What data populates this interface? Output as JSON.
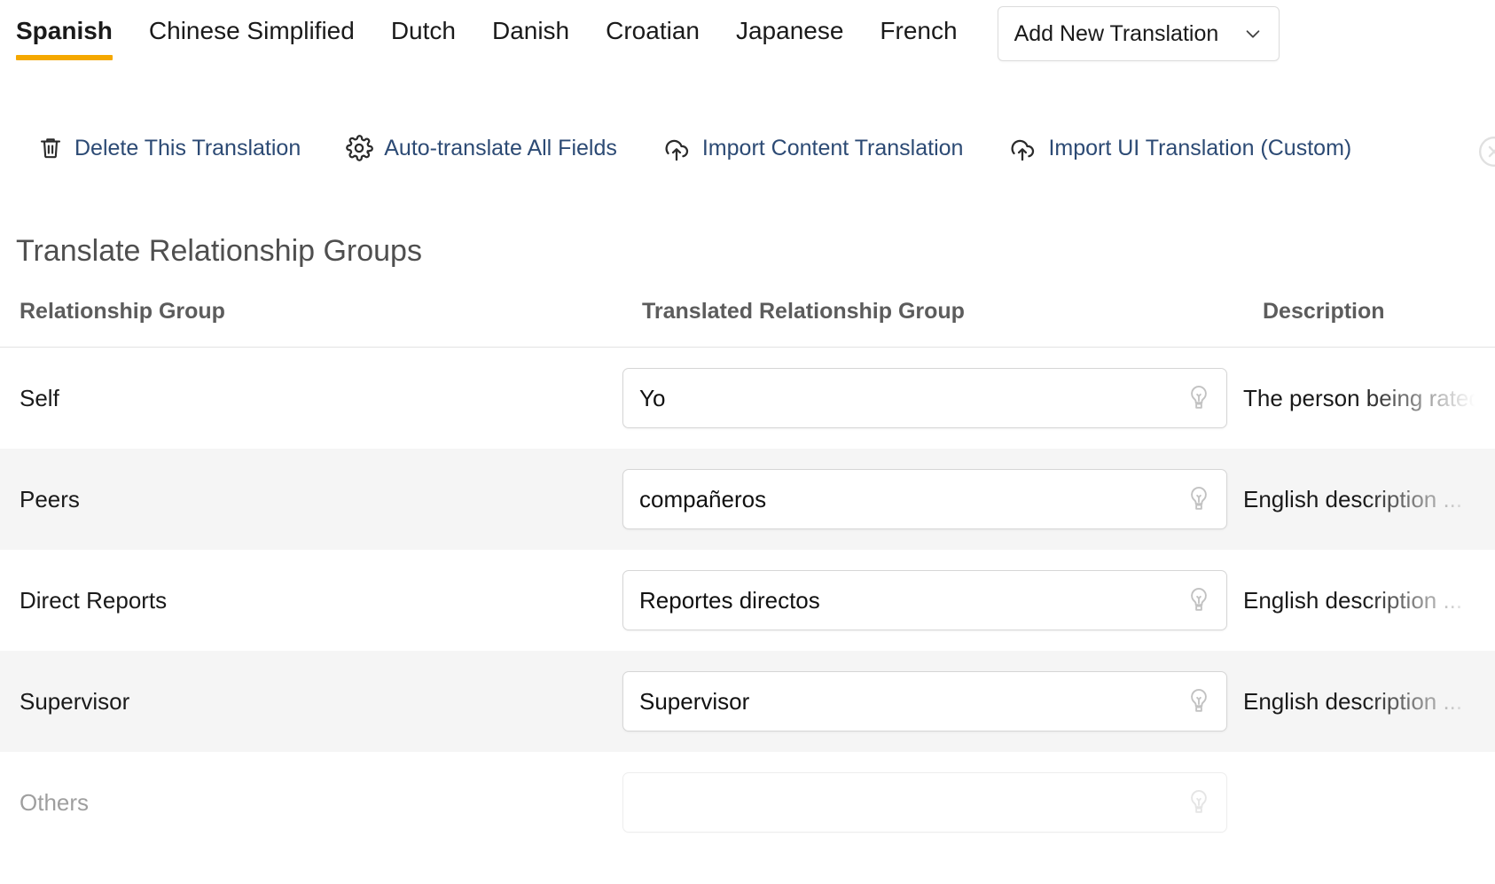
{
  "tabs": [
    {
      "label": "Spanish",
      "active": true
    },
    {
      "label": "Chinese Simplified",
      "active": false
    },
    {
      "label": "Dutch",
      "active": false
    },
    {
      "label": "Danish",
      "active": false
    },
    {
      "label": "Croatian",
      "active": false
    },
    {
      "label": "Japanese",
      "active": false
    },
    {
      "label": "French",
      "active": false
    }
  ],
  "add_translation": {
    "label": "Add New Translation",
    "icon": "chevron-down-icon"
  },
  "toolbar": {
    "actions": [
      {
        "label": "Delete This Translation",
        "icon": "trash-icon"
      },
      {
        "label": "Auto-translate All Fields",
        "icon": "gear-icon"
      },
      {
        "label": "Import Content Translation",
        "icon": "cloud-upload-icon"
      },
      {
        "label": "Import UI Translation (Custom)",
        "icon": "cloud-upload-icon"
      }
    ],
    "close_icon": "close-circle-icon"
  },
  "page_title": "Translate Relationship Groups",
  "table": {
    "columns": [
      "Relationship Group",
      "Translated Relationship Group",
      "Description"
    ],
    "rows": [
      {
        "name": "Self",
        "translation": "Yo",
        "description": "The person being rated",
        "hint_icon": "lightbulb-icon"
      },
      {
        "name": "Peers",
        "translation": "compañeros",
        "description": "English description ...",
        "hint_icon": "lightbulb-icon"
      },
      {
        "name": "Direct Reports",
        "translation": "Reportes directos",
        "description": "English description ...",
        "hint_icon": "lightbulb-icon"
      },
      {
        "name": "Supervisor",
        "translation": "Supervisor",
        "description": "English description ...",
        "hint_icon": "lightbulb-icon"
      },
      {
        "name": "Others",
        "translation": "",
        "description": "",
        "hint_icon": "lightbulb-icon"
      }
    ]
  },
  "colors": {
    "active_tab_underline": "#f5a800",
    "link_text": "#2c4a74",
    "alt_row_background": "#f5f5f5",
    "page_title": "#4f4f4f",
    "column_header": "#5c5c5c"
  }
}
